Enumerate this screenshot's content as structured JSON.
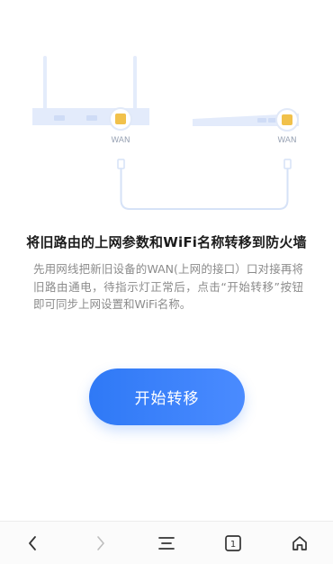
{
  "illustration": {
    "left_port_label": "WAN",
    "right_port_label": "WAN"
  },
  "content": {
    "title": "将旧路由的上网参数和WiFi名称转移到防火墙",
    "description": "先用网线把新旧设备的WAN(上网的接口）口对接再将旧路由通电，待指示灯正常后，点击“开始转移”按钮即可同步上网设置和WiFi名称。",
    "start_button_label": "开始转移"
  },
  "bottom_nav": {
    "tab_count": "1",
    "icons": [
      "back-icon",
      "forward-icon",
      "menu-icon",
      "tabs-icon",
      "home-icon"
    ]
  },
  "colors": {
    "accent": "#3a82f8",
    "router_body": "#e3ebfb",
    "port_yellow": "#f1c14b",
    "cable": "#d6e2f7"
  }
}
